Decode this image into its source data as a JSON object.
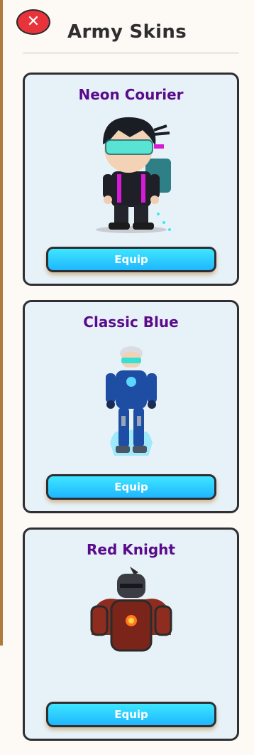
{
  "header": {
    "close_label": "✕",
    "title": "Army Skins"
  },
  "skins": [
    {
      "name": "Neon Courier",
      "button_label": "Equip",
      "icon": "neon-courier-character"
    },
    {
      "name": "Classic Blue",
      "button_label": "Equip",
      "icon": "classic-blue-character"
    },
    {
      "name": "Red Knight",
      "button_label": "Equip",
      "icon": "red-knight-character"
    }
  ],
  "colors": {
    "name_text": "#5a0a8c",
    "button": "#1fb6ff",
    "close": "#e8333a",
    "card_bg": "#e7f2f8"
  }
}
